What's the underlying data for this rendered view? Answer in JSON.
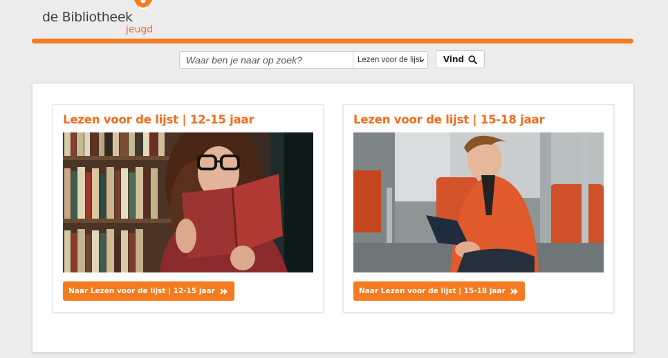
{
  "header": {
    "logo_main": "de Bibliotheek",
    "logo_sub": "jeugd"
  },
  "search": {
    "placeholder": "Waar ben je naar op zoek?",
    "value": "",
    "select_value": "Lezen voor de lijst",
    "button_label": "Vind"
  },
  "cards": [
    {
      "title": "Lezen voor de lijst | 12-15 jaar",
      "button_label": "Naar Lezen voor de lijst | 12-15 jaar"
    },
    {
      "title": "Lezen voor de lijst | 15-18 jaar",
      "button_label": "Naar Lezen voor de lijst | 15-18 jaar"
    }
  ],
  "colors": {
    "accent": "#f47b20",
    "title": "#f26c1d",
    "background": "#ececec"
  },
  "icons": {
    "search": "magnifier-icon",
    "select": "chevron-down-icon",
    "button": "arrow-right-circle-icon",
    "logo": "reader-figure-logo-icon"
  }
}
